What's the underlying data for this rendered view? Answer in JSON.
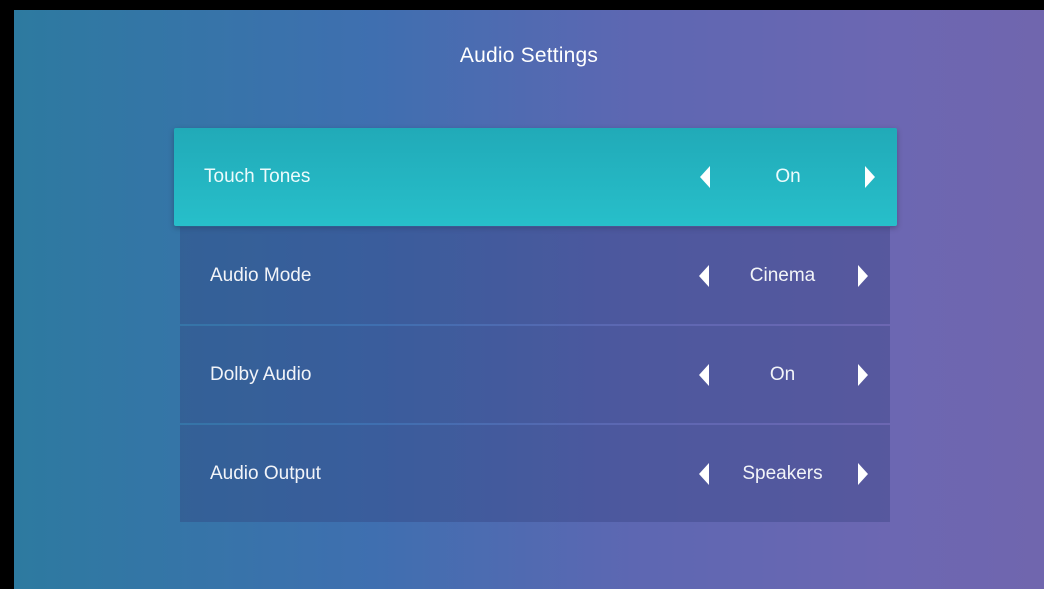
{
  "page": {
    "title": "Audio Settings"
  },
  "menu": {
    "items": [
      {
        "label": "Touch Tones",
        "value": "On",
        "selected": true,
        "left_icon": "triangle-left-icon",
        "right_icon": "triangle-right-icon"
      },
      {
        "label": "Audio Mode",
        "value": "Cinema",
        "selected": false,
        "left_icon": "triangle-left-icon",
        "right_icon": "triangle-right-icon"
      },
      {
        "label": "Dolby Audio",
        "value": "On",
        "selected": false,
        "left_icon": "triangle-left-icon",
        "right_icon": "triangle-right-icon"
      },
      {
        "label": "Audio Output",
        "value": "Speakers",
        "selected": false,
        "left_icon": "triangle-left-icon",
        "right_icon": "triangle-right-icon"
      }
    ]
  },
  "colors": {
    "selected_row": "#27bfca",
    "background_left": "#2d7aa0",
    "background_right": "#7066ae",
    "text": "#ffffff"
  }
}
